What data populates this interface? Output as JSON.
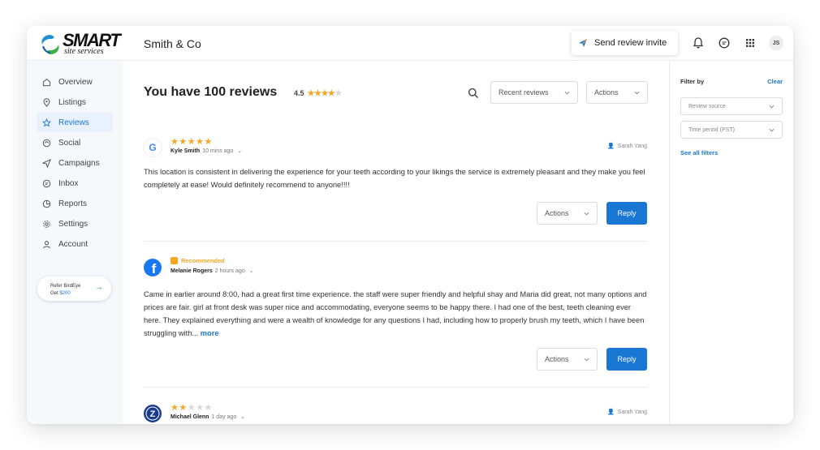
{
  "brand": {
    "name": "SMART",
    "tagline": "site services"
  },
  "company_name": "Smith & Co",
  "header": {
    "send_invite_label": "Send review invite",
    "avatar_initials": "JS",
    "icons": [
      "send-icon",
      "bell-icon",
      "chat-icon",
      "grid-icon"
    ]
  },
  "sidebar": {
    "items": [
      {
        "label": "Overview",
        "icon": "home-icon",
        "active": false
      },
      {
        "label": "Listings",
        "icon": "location-icon",
        "active": false
      },
      {
        "label": "Reviews",
        "icon": "star-icon",
        "active": true
      },
      {
        "label": "Social",
        "icon": "social-icon",
        "active": false
      },
      {
        "label": "Campaigns",
        "icon": "send-icon",
        "active": false
      },
      {
        "label": "Inbox",
        "icon": "inbox-icon",
        "active": false
      },
      {
        "label": "Reports",
        "icon": "pie-chart-icon",
        "active": false
      },
      {
        "label": "Settings",
        "icon": "gear-icon",
        "active": false
      },
      {
        "label": "Account",
        "icon": "user-icon",
        "active": false
      }
    ],
    "refer": {
      "line1": "Refer BirdEye",
      "line2_prefix": "Get",
      "amount": "$200"
    }
  },
  "main": {
    "heading": "You have 100 reviews",
    "rating": "4.5",
    "rating_stars": 4,
    "sort_select": "Recent reviews",
    "actions_label": "Actions"
  },
  "reviews": [
    {
      "source": "Google",
      "source_icon": "google-icon",
      "stars": 5,
      "recommended": "",
      "author": "Kyle Smith",
      "time": "10 mins ago",
      "assignee": "Sarah Yang",
      "text": "This location is consistent in delivering the experience for your teeth according to your likings the service is extremely pleasant and they make you feel completely at ease! Would definitely recommend to anyone!!!!",
      "more": "",
      "actions_label": "Actions",
      "reply_label": "Reply"
    },
    {
      "source": "Facebook",
      "source_icon": "facebook-icon",
      "stars": 0,
      "recommended": "Recommended",
      "author": "Melanie Rogers",
      "time": "2 hours ago",
      "assignee": "",
      "text": "Came in earlier around 8:00, had a great first time experience. the staff were super friendly and helpful shay and Maria did great, not many options and prices are fair. girl at front desk was super nice and accommodating, everyone seems to be happy there. I had one of the best, teeth cleaning ever here. They explained everything and were a wealth of knowledge for any questions I had, including how to properly brush my teeth, which I have been struggling with...",
      "more": "more",
      "actions_label": "Actions",
      "reply_label": "Reply"
    },
    {
      "source": "Other",
      "source_icon": "review-site-icon",
      "stars": 2,
      "recommended": "",
      "author": "Michael Glenn",
      "time": "1 day ago",
      "assignee": "Sarah Yang",
      "text": "",
      "more": "",
      "actions_label": "",
      "reply_label": ""
    }
  ],
  "filter": {
    "title": "Filter by",
    "clear": "Clear",
    "review_source": "Review source",
    "time_period": "Time period (PST)",
    "see_all": "See all filters"
  },
  "colors": {
    "accent": "#1976d2",
    "star": "#f5a623",
    "star_off": "#d8d8d8",
    "sidebar_bg": "#f6f8fb"
  }
}
